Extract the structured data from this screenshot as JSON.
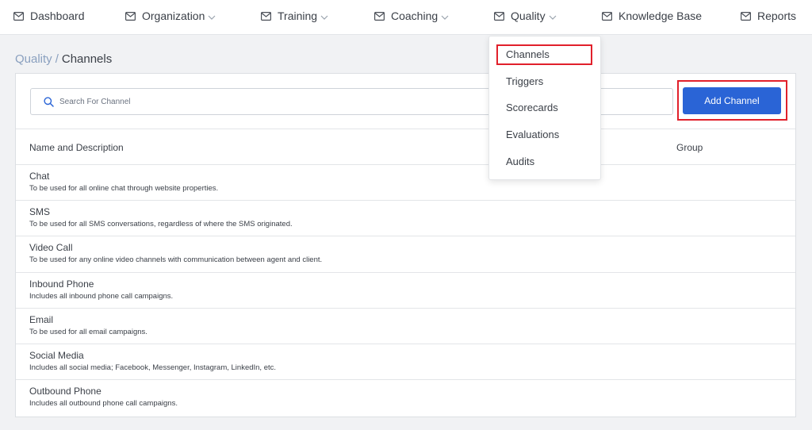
{
  "nav": {
    "items": [
      {
        "label": "Dashboard",
        "has_menu": false
      },
      {
        "label": "Organization",
        "has_menu": true
      },
      {
        "label": "Training",
        "has_menu": true
      },
      {
        "label": "Coaching",
        "has_menu": true
      },
      {
        "label": "Quality",
        "has_menu": true
      },
      {
        "label": "Knowledge Base",
        "has_menu": false
      },
      {
        "label": "Reports",
        "has_menu": false
      }
    ]
  },
  "breadcrumb": {
    "parent": "Quality",
    "separator": "/",
    "current": "Channels"
  },
  "search": {
    "placeholder": "Search For Channel",
    "value": ""
  },
  "toolbar": {
    "add_label": "Add Channel"
  },
  "table": {
    "columns": [
      "Name and Description",
      "Group"
    ],
    "rows": [
      {
        "name": "Chat",
        "description": "To be used for all online chat through website properties.",
        "group": ""
      },
      {
        "name": "SMS",
        "description": "To be used for all SMS conversations, regardless of where the SMS originated.",
        "group": ""
      },
      {
        "name": "Video Call",
        "description": "To be used for any online video channels with communication between agent and client.",
        "group": ""
      },
      {
        "name": "Inbound Phone",
        "description": "Includes all inbound phone call campaigns.",
        "group": ""
      },
      {
        "name": "Email",
        "description": "To be used for all email campaigns.",
        "group": ""
      },
      {
        "name": "Social Media",
        "description": "Includes all social media; Facebook, Messenger, Instagram, LinkedIn, etc.",
        "group": ""
      },
      {
        "name": "Outbound Phone",
        "description": "Includes all outbound phone call campaigns.",
        "group": ""
      }
    ]
  },
  "quality_menu": {
    "items": [
      "Channels",
      "Triggers",
      "Scorecards",
      "Evaluations",
      "Audits"
    ],
    "highlighted": "Channels"
  },
  "colors": {
    "primary": "#2a64d6",
    "highlight_outline": "#e1202b",
    "breadcrumb_link": "#8aa0bf",
    "page_bg": "#f1f2f4"
  },
  "icons": {
    "nav": "mail-icon",
    "menu": "chevron-down-icon",
    "search": "search-icon"
  }
}
